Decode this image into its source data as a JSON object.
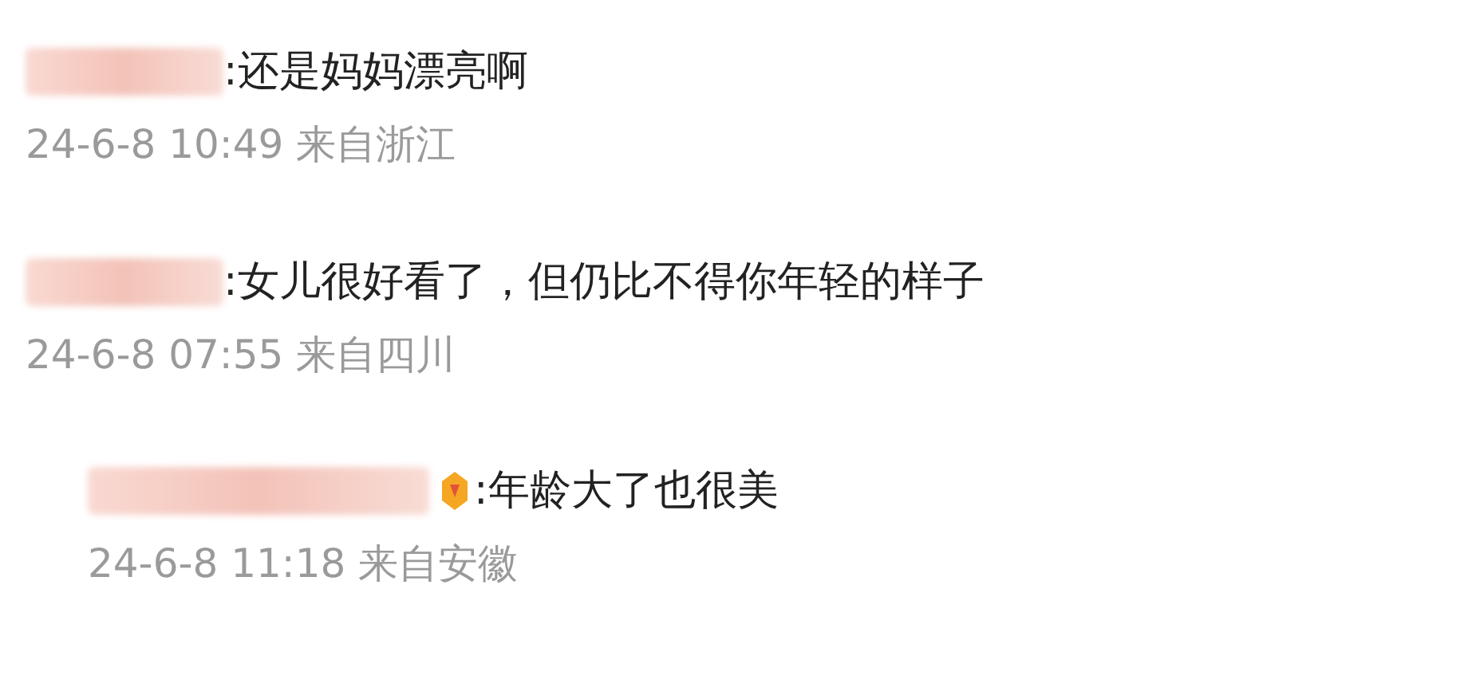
{
  "comments": [
    {
      "text": ":还是妈妈漂亮啊",
      "time": "24-6-8 10:49",
      "location": "来自浙江",
      "reply": false,
      "badge": false
    },
    {
      "text": ":女儿很好看了，但仍比不得你年轻的样子",
      "time": "24-6-8 07:55",
      "location": "来自四川",
      "reply": false,
      "badge": false
    },
    {
      "text": ":年龄大了也很美",
      "time": "24-6-8 11:18",
      "location": "来自安徽",
      "reply": true,
      "badge": true
    }
  ]
}
